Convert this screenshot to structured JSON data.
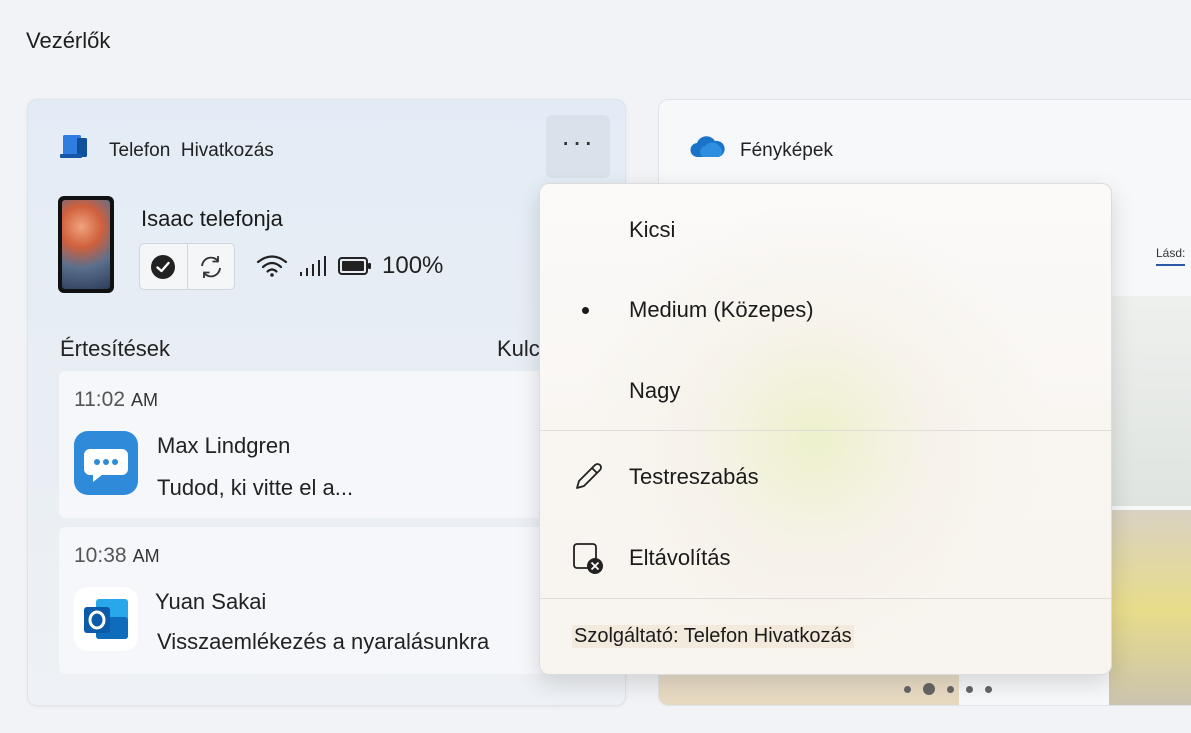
{
  "page": {
    "heading": "Vezérlők"
  },
  "phone_widget": {
    "title_app": "Telefon",
    "title_feature": "Hivatkozás",
    "more_label": "···",
    "device_name": "Isaac telefonja",
    "battery": "100%",
    "notifications_label": "Értesítések",
    "key_label": "Kulcs",
    "notifications": [
      {
        "time": "11:02",
        "ampm": "AM",
        "sender": "Max Lindgren",
        "message": "Tudod, ki vitte el a...",
        "icon": "messages-app-icon"
      },
      {
        "time": "10:38",
        "ampm": "AM",
        "sender": "Yuan Sakai",
        "message": "Visszaemlékezés a nyaralásunkra",
        "icon": "outlook-app-icon"
      }
    ]
  },
  "photos_widget": {
    "title": "Fényképek",
    "see_label": "Lásd:"
  },
  "context_menu": {
    "sizes": [
      {
        "label": "Kicsi",
        "selected": false
      },
      {
        "label": "Medium (Közepes)",
        "selected": true
      },
      {
        "label": "Nagy",
        "selected": false
      }
    ],
    "customize_label": "Testreszabás",
    "remove_label": "Eltávolítás",
    "provider_label": "Szolgáltató: Telefon  Hivatkozás"
  },
  "colors": {
    "accent_blue": "#2f7de1",
    "outlook_blue": "#0f6cbd",
    "onedrive_blue": "#1a73c9"
  }
}
